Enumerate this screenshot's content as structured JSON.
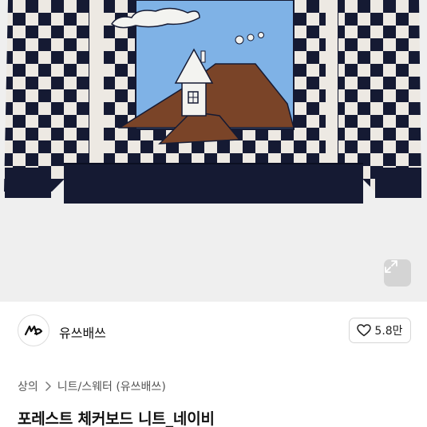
{
  "product": {
    "image_icon": "sweater-photo",
    "expand_icon": "expand-icon"
  },
  "brand": {
    "logo_icon": "brand-logo",
    "name": "유쓰배쓰"
  },
  "like": {
    "icon": "heart-outline-icon",
    "count": "5.8만"
  },
  "breadcrumb": {
    "items": [
      "상의",
      "니트/스웨터 (유쓰배쓰)"
    ],
    "separator_icon": "chevron-right-icon"
  },
  "title": "포레스트 체커보드 니트_네이비",
  "colors": {
    "navy": "#151a33",
    "cream": "#ede9e3",
    "sky": "#7fb2e6",
    "mountain": "#7a4428"
  }
}
